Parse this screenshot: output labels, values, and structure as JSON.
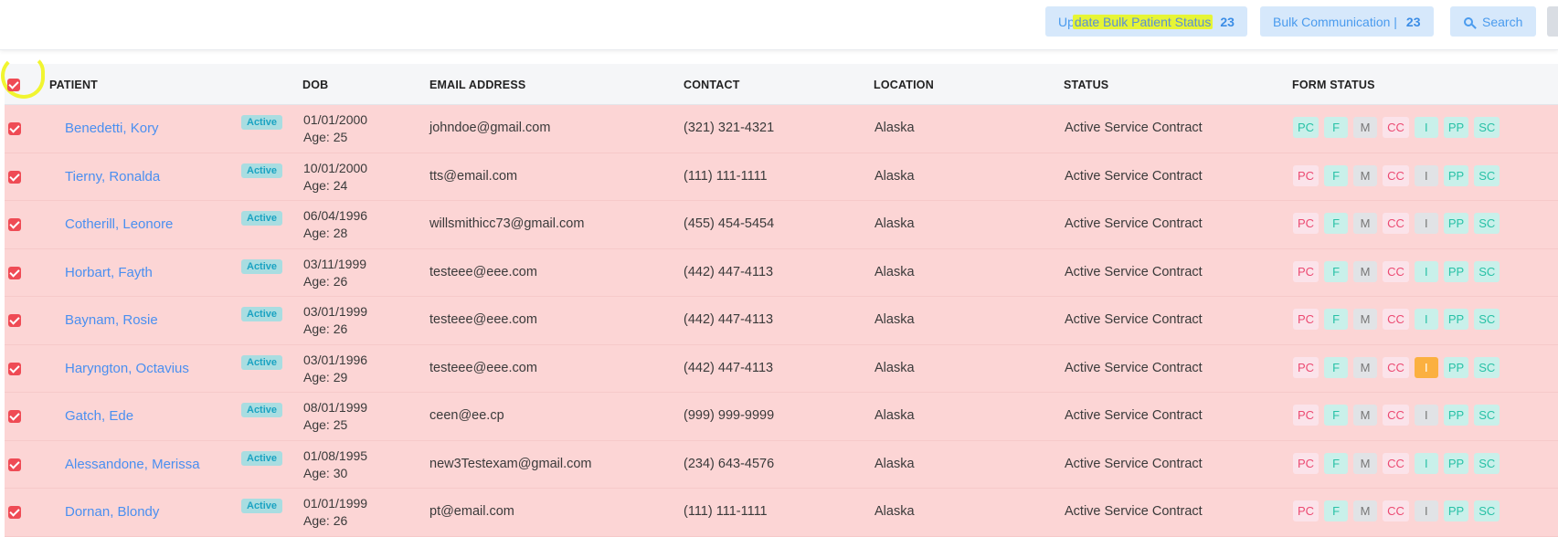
{
  "toolbar": {
    "bulk_status_prefix": "Up",
    "bulk_status_highlight": "date Bulk Patient Status",
    "bulk_status_count": "23",
    "bulk_comm_label": "Bulk Communication |",
    "bulk_comm_count": "23",
    "search_label": "Search"
  },
  "columns": {
    "patient": "PATIENT",
    "dob": "DOB",
    "email": "EMAIL ADDRESS",
    "contact": "CONTACT",
    "location": "LOCATION",
    "status": "STATUS",
    "form_status": "FORM STATUS"
  },
  "colors": {
    "row_selected_bg": "#fcd5d5",
    "link": "#4a8ff0",
    "checkbox": "#ef4b55",
    "highlight": "#e6f535"
  },
  "rows": [
    {
      "name": "Benedetti, Kory",
      "badge": "Active",
      "dob": "01/01/2000",
      "age": "Age: 25",
      "email": "johndoe@gmail.com",
      "contact": "(321) 321-4321",
      "location": "Alaska",
      "status": "Active Service Contract",
      "forms": [
        {
          "label": "PC",
          "state": "teal"
        },
        {
          "label": "F",
          "state": "teal"
        },
        {
          "label": "M",
          "state": "gray"
        },
        {
          "label": "CC",
          "state": "pink"
        },
        {
          "label": "I",
          "state": "teal"
        },
        {
          "label": "PP",
          "state": "teal"
        },
        {
          "label": "SC",
          "state": "teal"
        }
      ]
    },
    {
      "name": "Tierny, Ronalda",
      "badge": "Active",
      "dob": "10/01/2000",
      "age": "Age: 24",
      "email": "tts@email.com",
      "contact": "(111) 111-1111",
      "location": "Alaska",
      "status": "Active Service Contract",
      "forms": [
        {
          "label": "PC",
          "state": "pink"
        },
        {
          "label": "F",
          "state": "teal"
        },
        {
          "label": "M",
          "state": "gray"
        },
        {
          "label": "CC",
          "state": "pink"
        },
        {
          "label": "I",
          "state": "gray"
        },
        {
          "label": "PP",
          "state": "teal"
        },
        {
          "label": "SC",
          "state": "teal"
        }
      ]
    },
    {
      "name": "Cotherill, Leonore",
      "badge": "Active",
      "dob": "06/04/1996",
      "age": "Age: 28",
      "email": "willsmithicc73@gmail.com",
      "contact": "(455) 454-5454",
      "location": "Alaska",
      "status": "Active Service Contract",
      "forms": [
        {
          "label": "PC",
          "state": "pink"
        },
        {
          "label": "F",
          "state": "teal"
        },
        {
          "label": "M",
          "state": "gray"
        },
        {
          "label": "CC",
          "state": "pink"
        },
        {
          "label": "I",
          "state": "gray"
        },
        {
          "label": "PP",
          "state": "teal"
        },
        {
          "label": "SC",
          "state": "teal"
        }
      ]
    },
    {
      "name": "Horbart, Fayth",
      "badge": "Active",
      "dob": "03/11/1999",
      "age": "Age: 26",
      "email": "testeee@eee.com",
      "contact": "(442) 447-4113",
      "location": "Alaska",
      "status": "Active Service Contract",
      "forms": [
        {
          "label": "PC",
          "state": "pink"
        },
        {
          "label": "F",
          "state": "teal"
        },
        {
          "label": "M",
          "state": "gray"
        },
        {
          "label": "CC",
          "state": "pink"
        },
        {
          "label": "I",
          "state": "teal"
        },
        {
          "label": "PP",
          "state": "teal"
        },
        {
          "label": "SC",
          "state": "teal"
        }
      ]
    },
    {
      "name": "Baynam, Rosie",
      "badge": "Active",
      "dob": "03/01/1999",
      "age": "Age: 26",
      "email": "testeee@eee.com",
      "contact": "(442) 447-4113",
      "location": "Alaska",
      "status": "Active Service Contract",
      "forms": [
        {
          "label": "PC",
          "state": "pink"
        },
        {
          "label": "F",
          "state": "teal"
        },
        {
          "label": "M",
          "state": "gray"
        },
        {
          "label": "CC",
          "state": "pink"
        },
        {
          "label": "I",
          "state": "teal"
        },
        {
          "label": "PP",
          "state": "teal"
        },
        {
          "label": "SC",
          "state": "teal"
        }
      ]
    },
    {
      "name": "Haryngton, Octavius",
      "badge": "Active",
      "dob": "03/01/1996",
      "age": "Age: 29",
      "email": "testeee@eee.com",
      "contact": "(442) 447-4113",
      "location": "Alaska",
      "status": "Active Service Contract",
      "forms": [
        {
          "label": "PC",
          "state": "pink"
        },
        {
          "label": "F",
          "state": "teal"
        },
        {
          "label": "M",
          "state": "gray"
        },
        {
          "label": "CC",
          "state": "pink"
        },
        {
          "label": "I",
          "state": "orange"
        },
        {
          "label": "PP",
          "state": "teal"
        },
        {
          "label": "SC",
          "state": "teal"
        }
      ]
    },
    {
      "name": "Gatch, Ede",
      "badge": "Active",
      "dob": "08/01/1999",
      "age": "Age: 25",
      "email": "ceen@ee.cp",
      "contact": "(999) 999-9999",
      "location": "Alaska",
      "status": "Active Service Contract",
      "forms": [
        {
          "label": "PC",
          "state": "pink"
        },
        {
          "label": "F",
          "state": "teal"
        },
        {
          "label": "M",
          "state": "gray"
        },
        {
          "label": "CC",
          "state": "pink"
        },
        {
          "label": "I",
          "state": "gray"
        },
        {
          "label": "PP",
          "state": "teal"
        },
        {
          "label": "SC",
          "state": "teal"
        }
      ]
    },
    {
      "name": "Alessandone, Merissa",
      "badge": "Active",
      "dob": "01/08/1995",
      "age": "Age: 30",
      "email": "new3Testexam@gmail.com",
      "contact": "(234) 643-4576",
      "location": "Alaska",
      "status": "Active Service Contract",
      "forms": [
        {
          "label": "PC",
          "state": "pink"
        },
        {
          "label": "F",
          "state": "teal"
        },
        {
          "label": "M",
          "state": "gray"
        },
        {
          "label": "CC",
          "state": "pink"
        },
        {
          "label": "I",
          "state": "teal"
        },
        {
          "label": "PP",
          "state": "teal"
        },
        {
          "label": "SC",
          "state": "teal"
        }
      ]
    },
    {
      "name": "Dornan, Blondy",
      "badge": "Active",
      "dob": "01/01/1999",
      "age": "Age: 26",
      "email": "pt@email.com",
      "contact": "(111) 111-1111",
      "location": "Alaska",
      "status": "Active Service Contract",
      "forms": [
        {
          "label": "PC",
          "state": "pink"
        },
        {
          "label": "F",
          "state": "teal"
        },
        {
          "label": "M",
          "state": "gray"
        },
        {
          "label": "CC",
          "state": "pink"
        },
        {
          "label": "I",
          "state": "gray"
        },
        {
          "label": "PP",
          "state": "teal"
        },
        {
          "label": "SC",
          "state": "teal"
        }
      ]
    }
  ]
}
